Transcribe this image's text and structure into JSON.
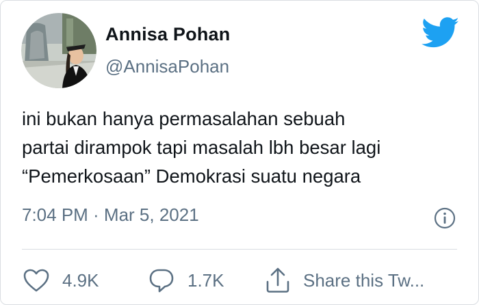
{
  "user": {
    "display_name": "Annisa Pohan",
    "handle": "@AnnisaPohan",
    "avatar_icon": "profile-photo"
  },
  "brand": {
    "icon": "twitter-bird-icon",
    "color": "#1da1f2"
  },
  "tweet": {
    "lines": [
      "ini bukan hanya permasalahan sebuah",
      "partai dirampok tapi masalah lbh besar lagi",
      "“Pemerkosaan” Demokrasi suatu negara"
    ],
    "timestamp": "7:04 PM · Mar 5, 2021"
  },
  "actions": {
    "like_count": "4.9K",
    "reply_count": "1.7K",
    "share_label": "Share this Tw..."
  },
  "colors": {
    "text": "#0f1419",
    "secondary": "#5b7083",
    "divider": "#d9dde1"
  }
}
